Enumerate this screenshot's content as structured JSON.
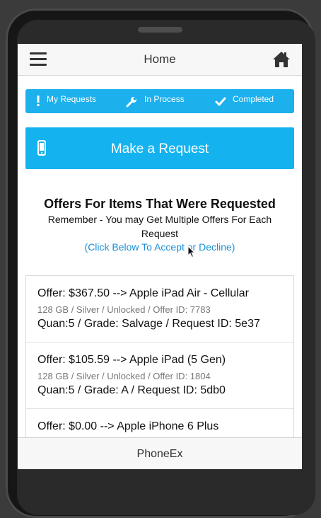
{
  "header": {
    "title": "Home",
    "menu_icon": "hamburger-menu-icon",
    "home_icon": "home-icon"
  },
  "tabs": [
    {
      "label": "My Requests",
      "icon": "exclamation-icon"
    },
    {
      "label": "In Process",
      "icon": "wrench-icon"
    },
    {
      "label": "Completed",
      "icon": "checkmark-icon"
    }
  ],
  "request_button": {
    "label": "Make a Request",
    "icon": "mobile-phone-icon"
  },
  "offers": {
    "title": "Offers For Items That Were Requested",
    "subtitle": "Remember - You may Get Multiple Offers For Each Request",
    "hint": "(Click Below To Accept or Decline)"
  },
  "items": [
    {
      "line1": "Offer: $367.50 --> Apple iPad Air - Cellular",
      "line2": "128 GB / Silver / Unlocked / Offer ID: 7783",
      "line3": "Quan:5 / Grade: Salvage / Request ID: 5e37"
    },
    {
      "line1": "Offer: $105.59 --> Apple iPad (5 Gen)",
      "line2": "128 GB / Silver / Unlocked / Offer ID: 1804",
      "line3": "Quan:5 / Grade: A / Request ID: 5db0"
    },
    {
      "line1": "Offer: $0.00 --> Apple iPhone 6 Plus",
      "line2": "",
      "line3": ""
    }
  ],
  "footer": {
    "brand": "PhoneEx"
  },
  "colors": {
    "accent": "#1cb0ec",
    "button": "#14b3ef",
    "link": "#1a8fd6"
  }
}
